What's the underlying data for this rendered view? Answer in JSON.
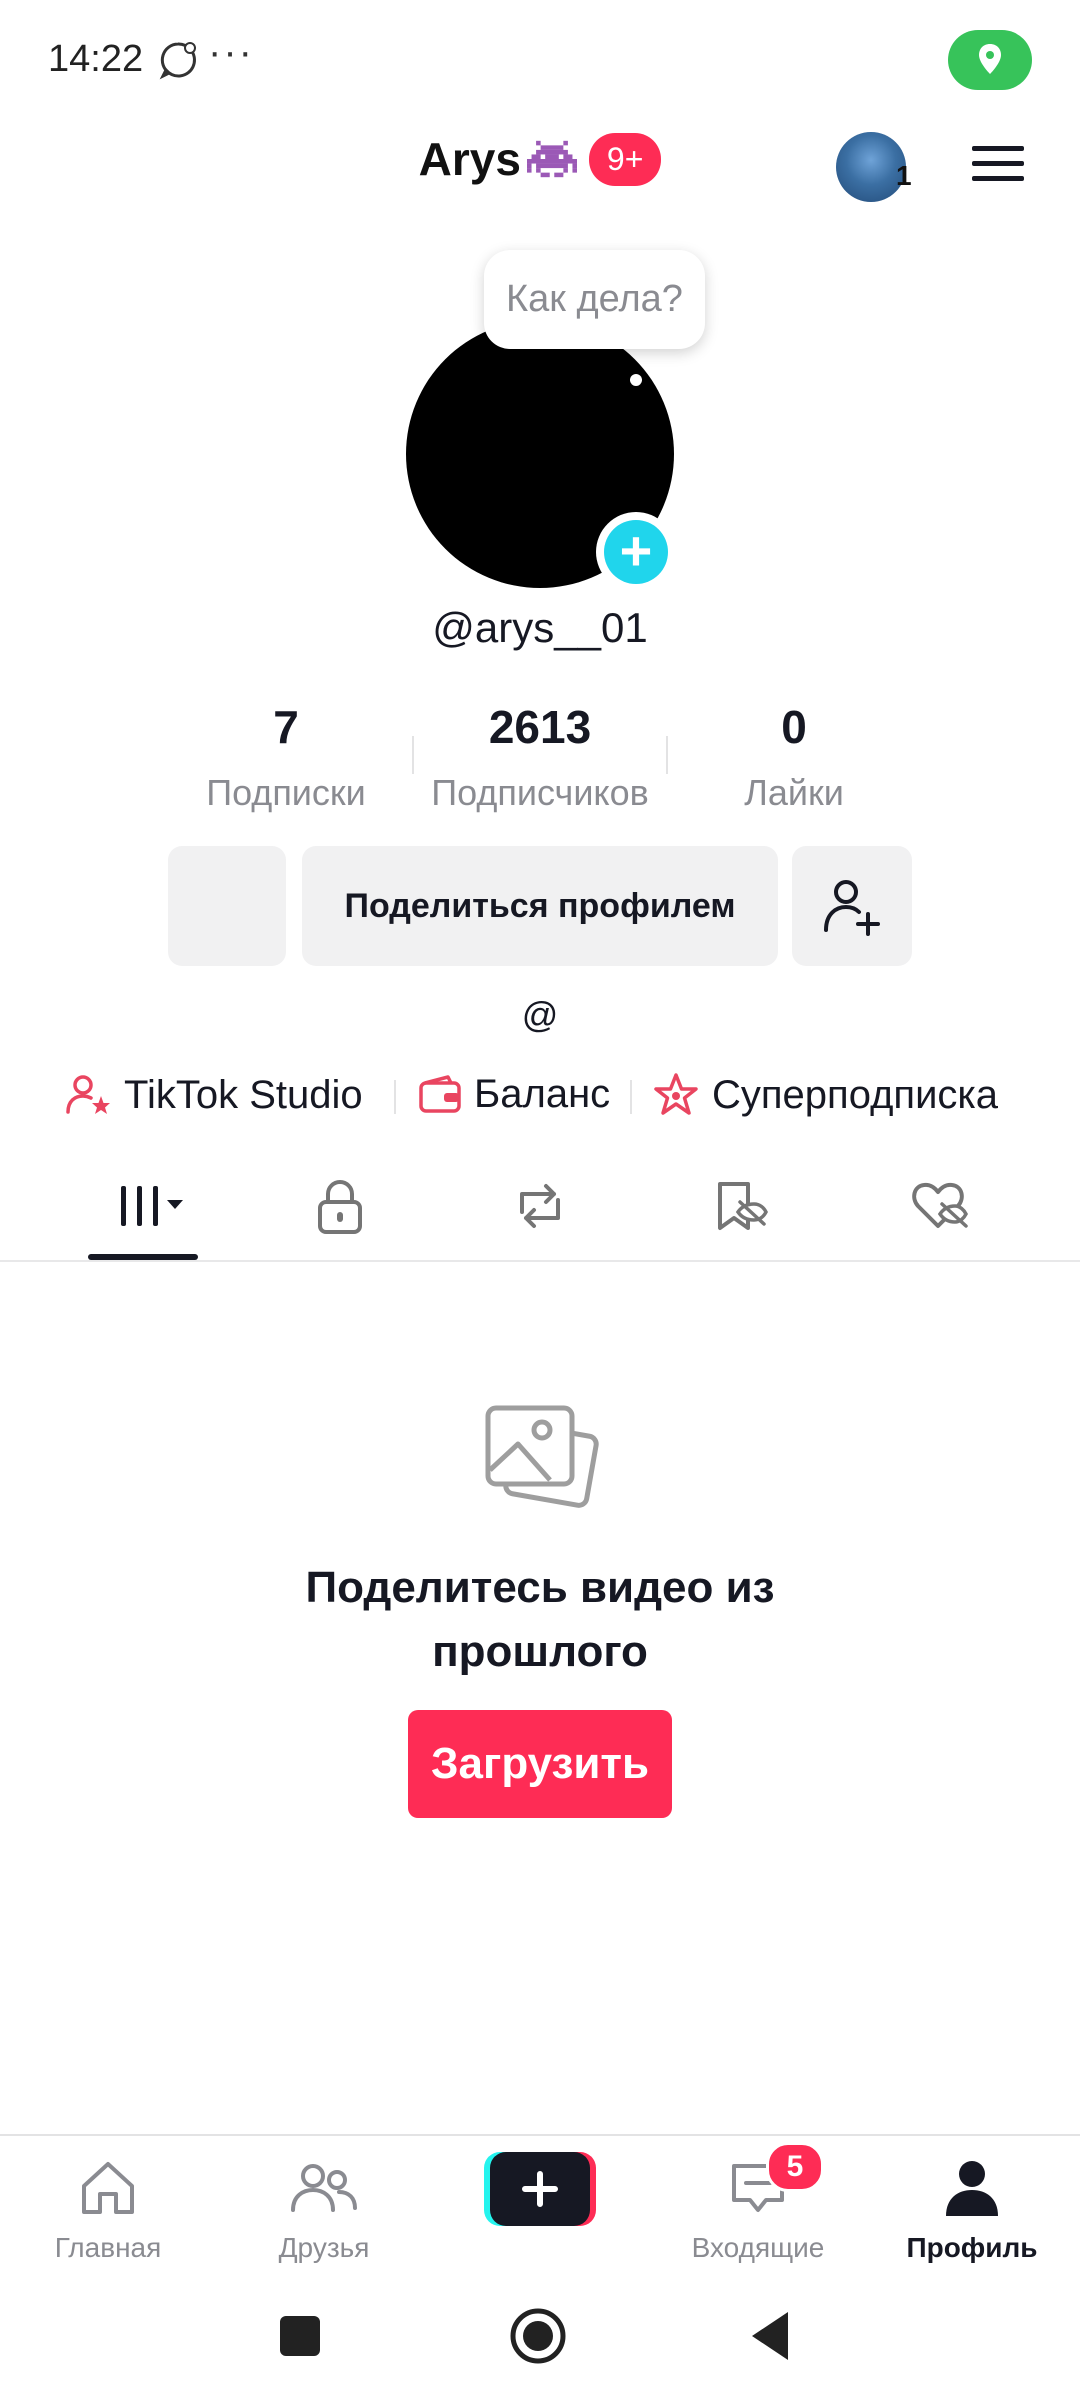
{
  "status_bar": {
    "time": "14:22",
    "dots": "···"
  },
  "header": {
    "username": "Arys",
    "notification_badge": "9+",
    "account_count": "1"
  },
  "profile": {
    "bubble_text": "Как дела?",
    "handle": "@arys__01",
    "add_avatar_symbol": "+"
  },
  "stats": [
    {
      "value": "7",
      "label": "Подписки"
    },
    {
      "value": "2613",
      "label": "Подписчиков"
    },
    {
      "value": "0",
      "label": "Лайки"
    }
  ],
  "actions": {
    "share_profile": "Поделиться профилем"
  },
  "bio": "@",
  "links": [
    {
      "label": "TikTok Studio",
      "icon": "creator-studio-icon"
    },
    {
      "label": "Баланс",
      "icon": "wallet-icon"
    },
    {
      "label": "Суперподписка",
      "icon": "super-subscription-icon"
    }
  ],
  "tabs": [
    "videos-grid-icon",
    "lock-icon",
    "repost-icon",
    "favorites-hidden-icon",
    "liked-hidden-icon"
  ],
  "empty_state": {
    "title": "Поделитесь видео из прошлого",
    "upload_button": "Загрузить"
  },
  "bottom_nav": [
    {
      "label": "Главная",
      "icon": "home-icon"
    },
    {
      "label": "Друзья",
      "icon": "friends-icon"
    },
    {
      "label": "",
      "icon": "create-plus-icon"
    },
    {
      "label": "Входящие",
      "icon": "inbox-icon",
      "badge": "5"
    },
    {
      "label": "Профиль",
      "icon": "profile-icon"
    }
  ],
  "colors": {
    "accent": "#fe2c55",
    "teal": "#20d5ec",
    "location_green": "#37c35a"
  }
}
